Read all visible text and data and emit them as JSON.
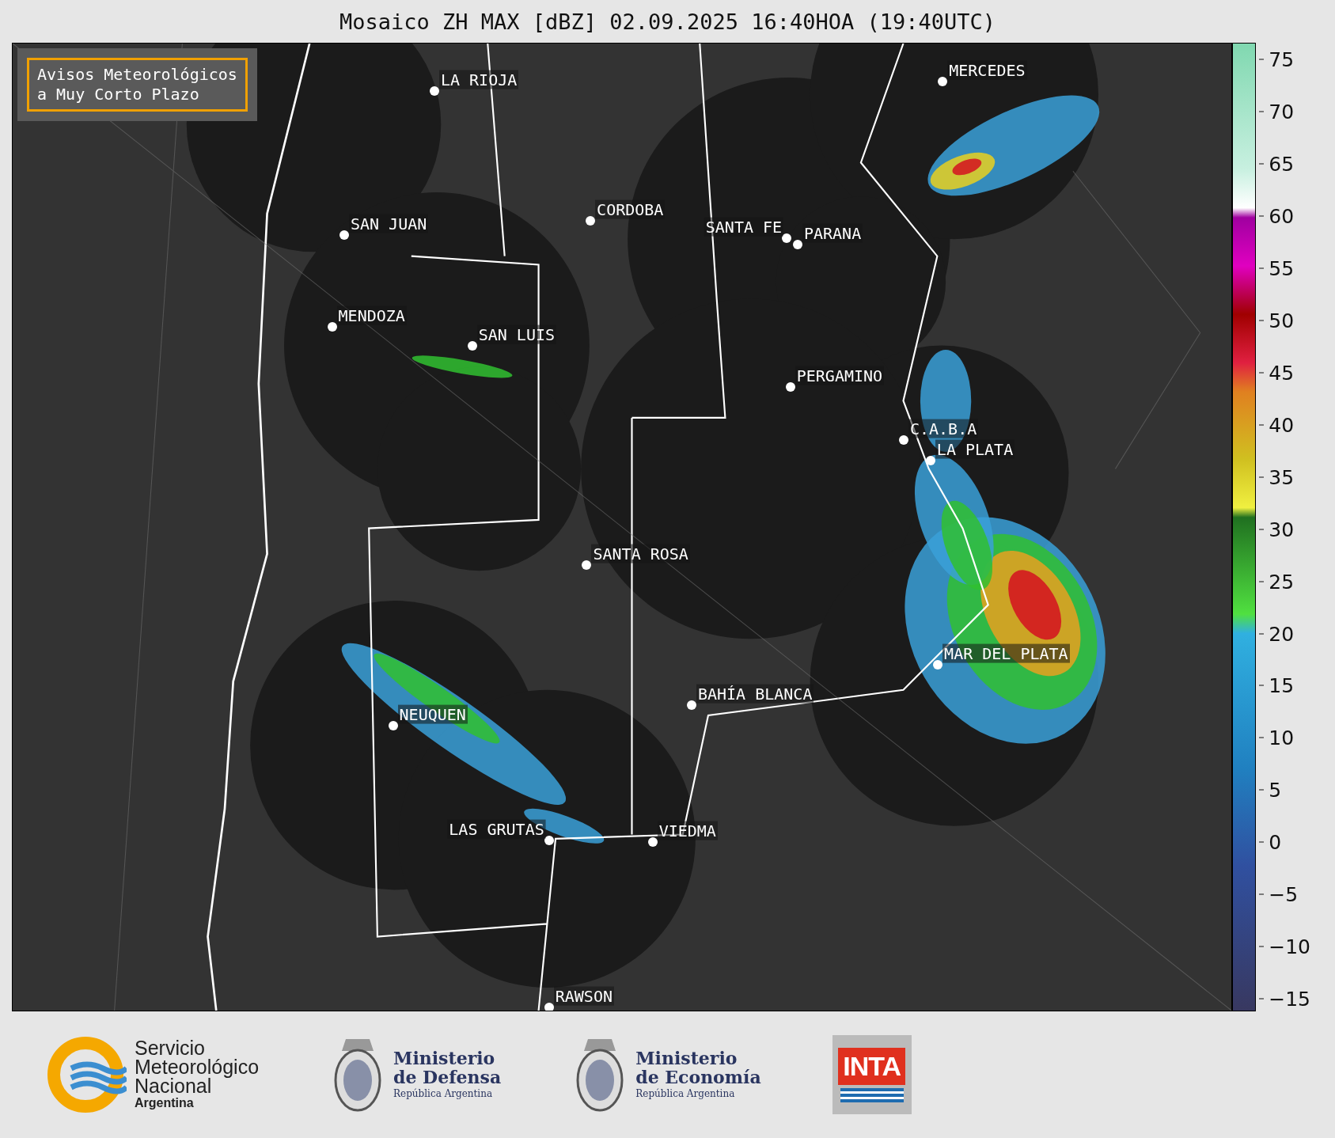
{
  "title": "Mosaico ZH MAX [dBZ] 02.09.2025 16:40HOA (19:40UTC)",
  "notice": {
    "lines": [
      "Avisos Meteorológicos",
      "a Muy Corto Plazo"
    ]
  },
  "cities": [
    {
      "name": "LA RIOJA"
    },
    {
      "name": "MERCEDES"
    },
    {
      "name": "CORDOBA"
    },
    {
      "name": "SAN JUAN"
    },
    {
      "name": "SANTA FE"
    },
    {
      "name": "PARANA"
    },
    {
      "name": "MENDOZA"
    },
    {
      "name": "SAN LUIS"
    },
    {
      "name": "PERGAMINO"
    },
    {
      "name": "C.A.B.A"
    },
    {
      "name": "LA PLATA"
    },
    {
      "name": "SANTA ROSA"
    },
    {
      "name": "MAR DEL PLATA"
    },
    {
      "name": "BAHÍA BLANCA"
    },
    {
      "name": "NEUQUEN"
    },
    {
      "name": "LAS GRUTAS"
    },
    {
      "name": "VIEDMA"
    },
    {
      "name": "RAWSON"
    }
  ],
  "colorbar": {
    "ticks": [
      "75",
      "70",
      "65",
      "60",
      "55",
      "50",
      "45",
      "40",
      "35",
      "30",
      "25",
      "20",
      "15",
      "10",
      "5",
      "0",
      "−5",
      "−10",
      "−15"
    ]
  },
  "logos": [
    {
      "kind": "smn",
      "lines": [
        "Servicio",
        "Meteorológico",
        "Nacional",
        "Argentina"
      ]
    },
    {
      "kind": "ministry",
      "lines": [
        "Ministerio",
        "de Defensa",
        "República Argentina"
      ]
    },
    {
      "kind": "ministry",
      "lines": [
        "Ministerio",
        "de Economía",
        "República Argentina"
      ]
    },
    {
      "kind": "inta",
      "lines": [
        "INTA"
      ]
    }
  ]
}
